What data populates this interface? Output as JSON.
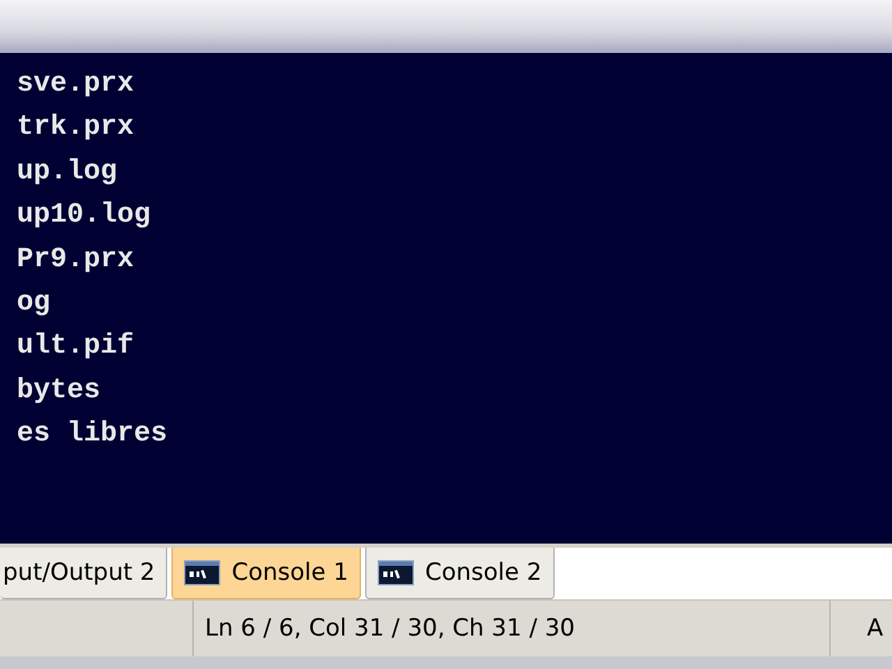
{
  "console": {
    "lines": [
      "sve.prx",
      "trk.prx",
      "up.log",
      "up10.log",
      "Pr9.prx",
      "og",
      "ult.pif",
      "bytes",
      "es libres"
    ]
  },
  "tabs": [
    {
      "label": "put/Output 2",
      "selected": false,
      "icon": false
    },
    {
      "label": "Console 1",
      "selected": true,
      "icon": true
    },
    {
      "label": "Console 2",
      "selected": false,
      "icon": true
    }
  ],
  "status_bar": {
    "position": "Ln 6 / 6, Col 31 / 30, Ch 31 / 30",
    "extra": "A"
  }
}
